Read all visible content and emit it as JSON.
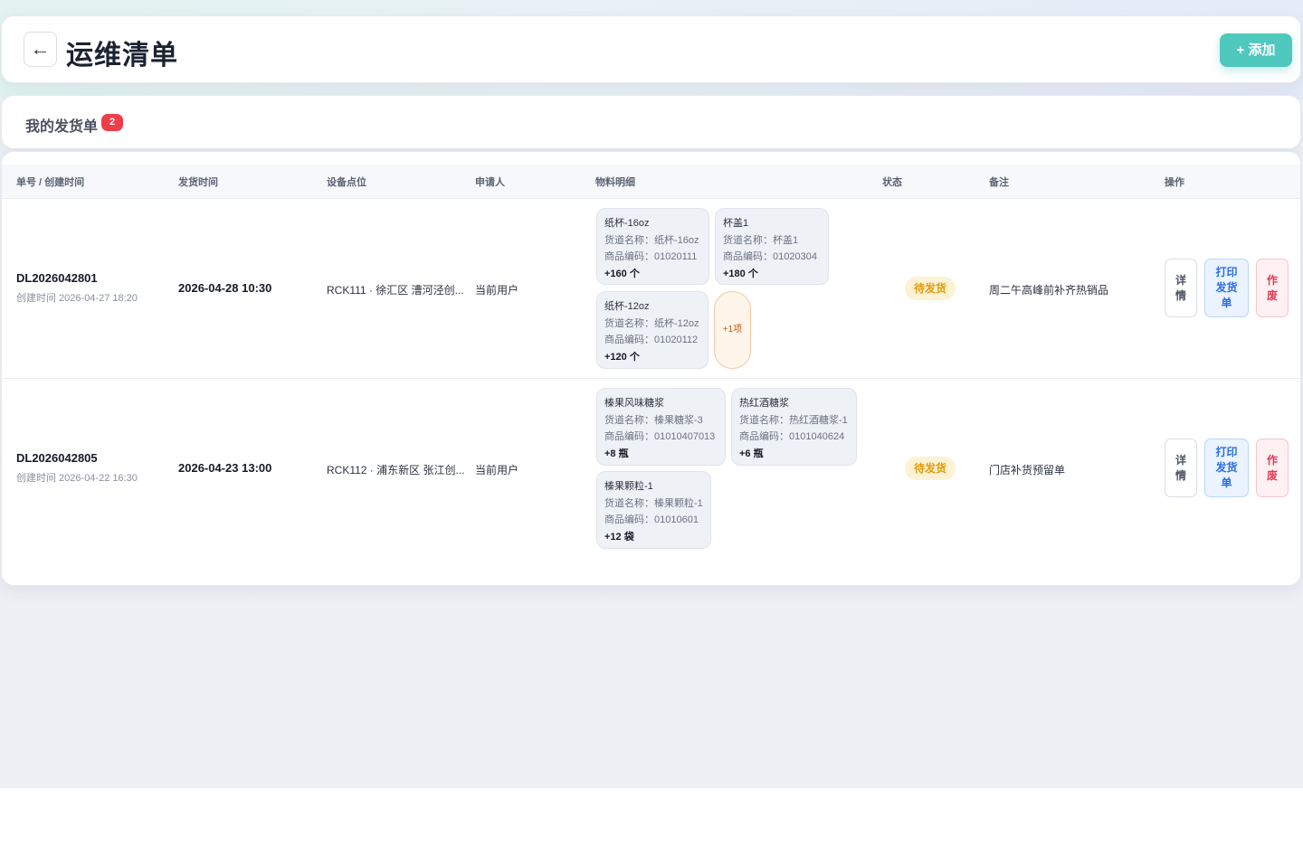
{
  "header": {
    "back_icon": "←",
    "title": "运维清单",
    "add_label": "+ 添加"
  },
  "section": {
    "title": "我的发货单",
    "count": "2"
  },
  "table": {
    "columns": [
      "单号 / 创建时间",
      "发货时间",
      "设备点位",
      "申请人",
      "物料明细",
      "状态",
      "备注",
      "操作"
    ],
    "rows": [
      {
        "order_no": "DL2026042801",
        "created": "创建时间 2026-04-27 18:20",
        "ship_time": "2026-04-28 10:30",
        "location": "RCK111 · 徐汇区 漕河泾创...",
        "applicant": "当前用户",
        "materials": [
          {
            "name": "纸杯-16oz",
            "channel": "货道名称：纸杯-16oz",
            "code": "商品编码：01020111",
            "qty": "+160 个"
          },
          {
            "name": "杯盖1",
            "channel": "货道名称：杯盖1",
            "code": "商品编码：01020304",
            "qty": "+180 个"
          },
          {
            "name": "纸杯-12oz",
            "channel": "货道名称：纸杯-12oz",
            "code": "商品编码：01020112",
            "qty": "+120 个"
          }
        ],
        "more": "+1项",
        "status": "待发货",
        "remark": "周二午高峰前补齐热销品",
        "actions": {
          "detail": "详情",
          "print": "打印发货单",
          "void": "作废"
        }
      },
      {
        "order_no": "DL2026042805",
        "created": "创建时间 2026-04-22 16:30",
        "ship_time": "2026-04-23 13:00",
        "location": "RCK112 · 浦东新区 张江创...",
        "applicant": "当前用户",
        "materials": [
          {
            "name": "榛果风味糖浆",
            "channel": "货道名称：榛果糖浆-3",
            "code": "商品编码：01010407013",
            "qty": "+8 瓶"
          },
          {
            "name": "热红酒糖浆",
            "channel": "货道名称：热红酒糖浆-1",
            "code": "商品编码：0101040624",
            "qty": "+6 瓶"
          },
          {
            "name": "榛果颗粒-1",
            "channel": "货道名称：榛果颗粒-1",
            "code": "商品编码：01010601",
            "qty": "+12 袋"
          }
        ],
        "status": "待发货",
        "remark": "门店补货预留单",
        "actions": {
          "detail": "详情",
          "print": "打印发货单",
          "void": "作废"
        }
      }
    ]
  },
  "colors": {
    "accent": "#4fc8bd",
    "badge": "#ef3e4a",
    "pending": "#e39b0b",
    "print": "#2b6fe0",
    "void": "#e23a55"
  }
}
